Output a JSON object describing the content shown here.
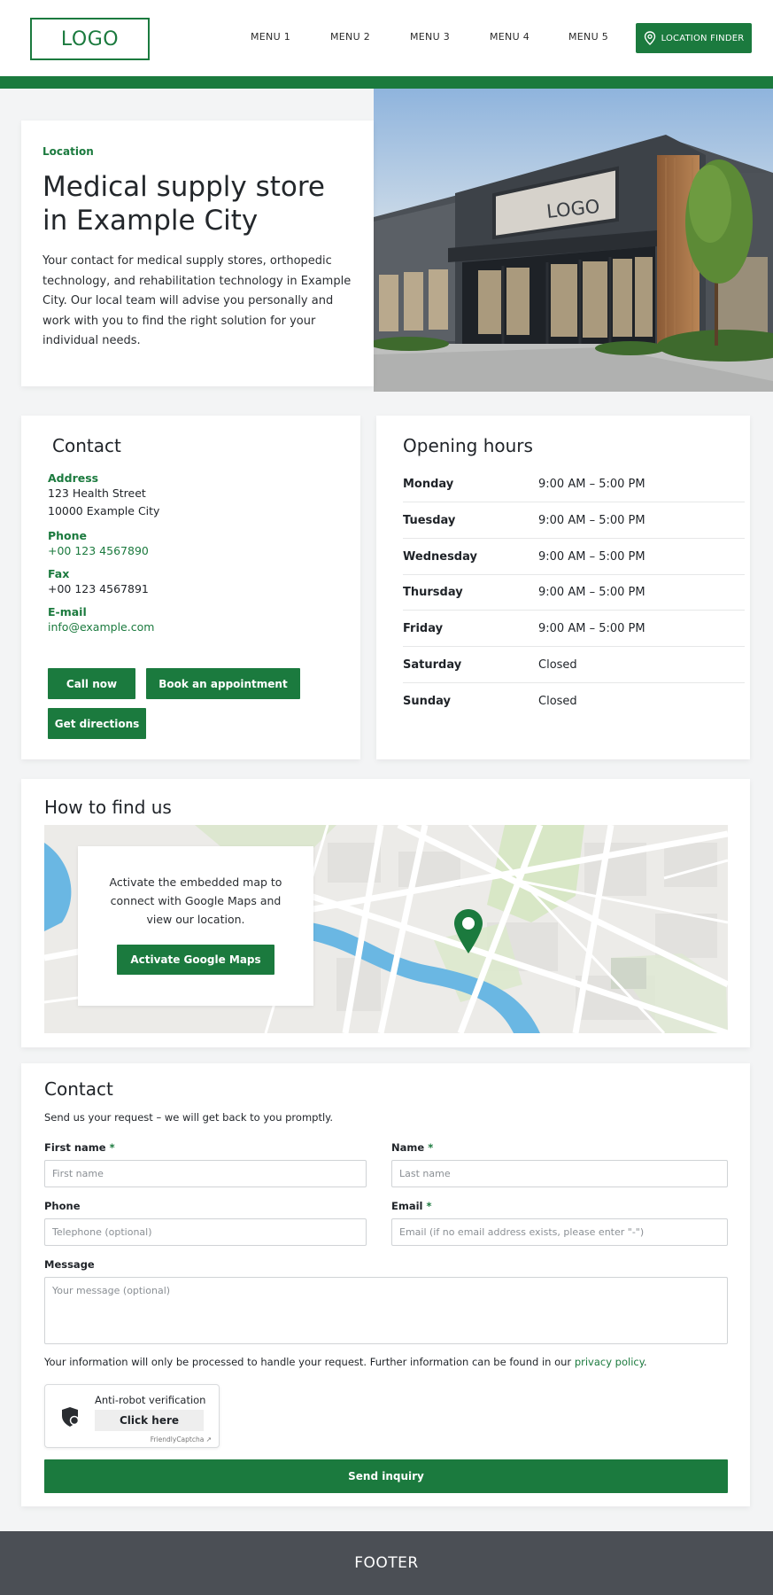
{
  "header": {
    "logo": "LOGO",
    "menu": [
      "MENU 1",
      "MENU 2",
      "MENU 3",
      "MENU 4",
      "MENU 5"
    ],
    "location_button": "LOCATION FINDER",
    "location_icon": "map-pin-icon",
    "brand_color": "#1b7a3e"
  },
  "hero": {
    "eyebrow": "Location",
    "title": "Medical supply store in Example City",
    "text": "Your contact for medical supply stores, orthopedic technology, and rehabilitation technology in Example City. Our local team will advise you personally and work with you to find the right solution for your individual needs.",
    "image_sign": "LOGO"
  },
  "contact_card": {
    "title": "Contact",
    "address_label": "Address",
    "address_line1": "123 Health Street",
    "address_line2": "10000 Example City",
    "phone_label": "Phone",
    "phone": "+00 123 4567890",
    "fax_label": "Fax",
    "fax": "+00 123 4567891",
    "email_label": "E-mail",
    "email": "info@example.com",
    "call_button": "Call now",
    "book_button": "Book an appointment",
    "directions_button": "Get directions"
  },
  "hours": {
    "title": "Opening hours",
    "rows": [
      {
        "day": "Monday",
        "time": "9:00 AM – 5:00 PM"
      },
      {
        "day": "Tuesday",
        "time": "9:00 AM – 5:00 PM"
      },
      {
        "day": "Wednesday",
        "time": "9:00 AM – 5:00 PM"
      },
      {
        "day": "Thursday",
        "time": "9:00 AM – 5:00 PM"
      },
      {
        "day": "Friday",
        "time": "9:00 AM – 5:00 PM"
      },
      {
        "day": "Saturday",
        "time": "Closed"
      },
      {
        "day": "Sunday",
        "time": "Closed"
      }
    ]
  },
  "map": {
    "title": "How to find us",
    "text": "Activate the embedded map to connect with Google Maps and view our location.",
    "button": "Activate Google Maps",
    "pin_icon": "map-marker-icon"
  },
  "form": {
    "title": "Contact",
    "subtitle": "Send us your request – we will get back to you promptly.",
    "first_name_label": "First name",
    "first_name_placeholder": "First name",
    "name_label": "Name",
    "name_placeholder": "Last name",
    "phone_label": "Phone",
    "phone_placeholder": "Telephone (optional)",
    "email_label": "Email",
    "email_placeholder": "Email (if no email address exists, please enter \"-\")",
    "message_label": "Message",
    "message_placeholder": "Your message (optional)",
    "required_mark": "*",
    "privacy_text": "Your information will only be processed to handle your request. Further information can be found in our",
    "privacy_link": "privacy policy",
    "privacy_end": ".",
    "captcha_title": "Anti-robot verification",
    "captcha_button": "Click here",
    "captcha_brand": "FriendlyCaptcha ↗",
    "captcha_icon": "shield-icon",
    "submit": "Send inquiry"
  },
  "footer": {
    "label": "FOOTER"
  }
}
